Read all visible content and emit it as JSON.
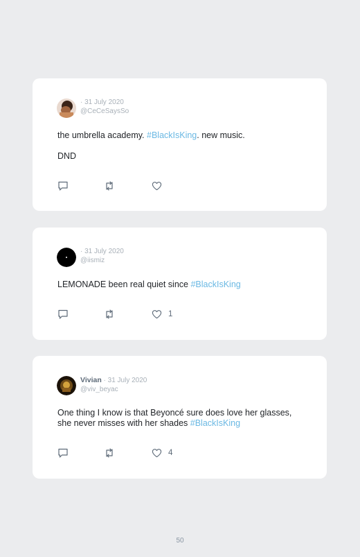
{
  "tweets": [
    {
      "name": "",
      "date": "· 31 July 2020",
      "handle": "@CeCeSaysSo",
      "paragraphs": [
        {
          "before": "the umbrella academy. ",
          "hashtag": "#BlackIsKing",
          "after": ". new music."
        },
        {
          "before": "DND",
          "hashtag": "",
          "after": ""
        }
      ],
      "likes": ""
    },
    {
      "name": "",
      "date": "· 31 July 2020",
      "handle": "@iismiz",
      "paragraphs": [
        {
          "before": "LEMONADE been real quiet since ",
          "hashtag": "#BlackIsKing",
          "after": ""
        }
      ],
      "likes": "1"
    },
    {
      "name": "Vivian",
      "date": "· 31 July 2020",
      "handle": "@viv_beyac",
      "paragraphs": [
        {
          "before": "One thing I know is that Beyoncé sure does love her glasses, she never misses with her shades ",
          "hashtag": "#BlackIsKing",
          "after": ""
        }
      ],
      "likes": "4"
    }
  ],
  "icons": [
    "reply-icon",
    "retweet-icon",
    "like-icon"
  ],
  "colors": {
    "background": "#ebecee",
    "card": "#ffffff",
    "hashtag": "#6ab8e3",
    "muted": "#a8b0b8"
  },
  "footer": {
    "page_number": "50"
  }
}
